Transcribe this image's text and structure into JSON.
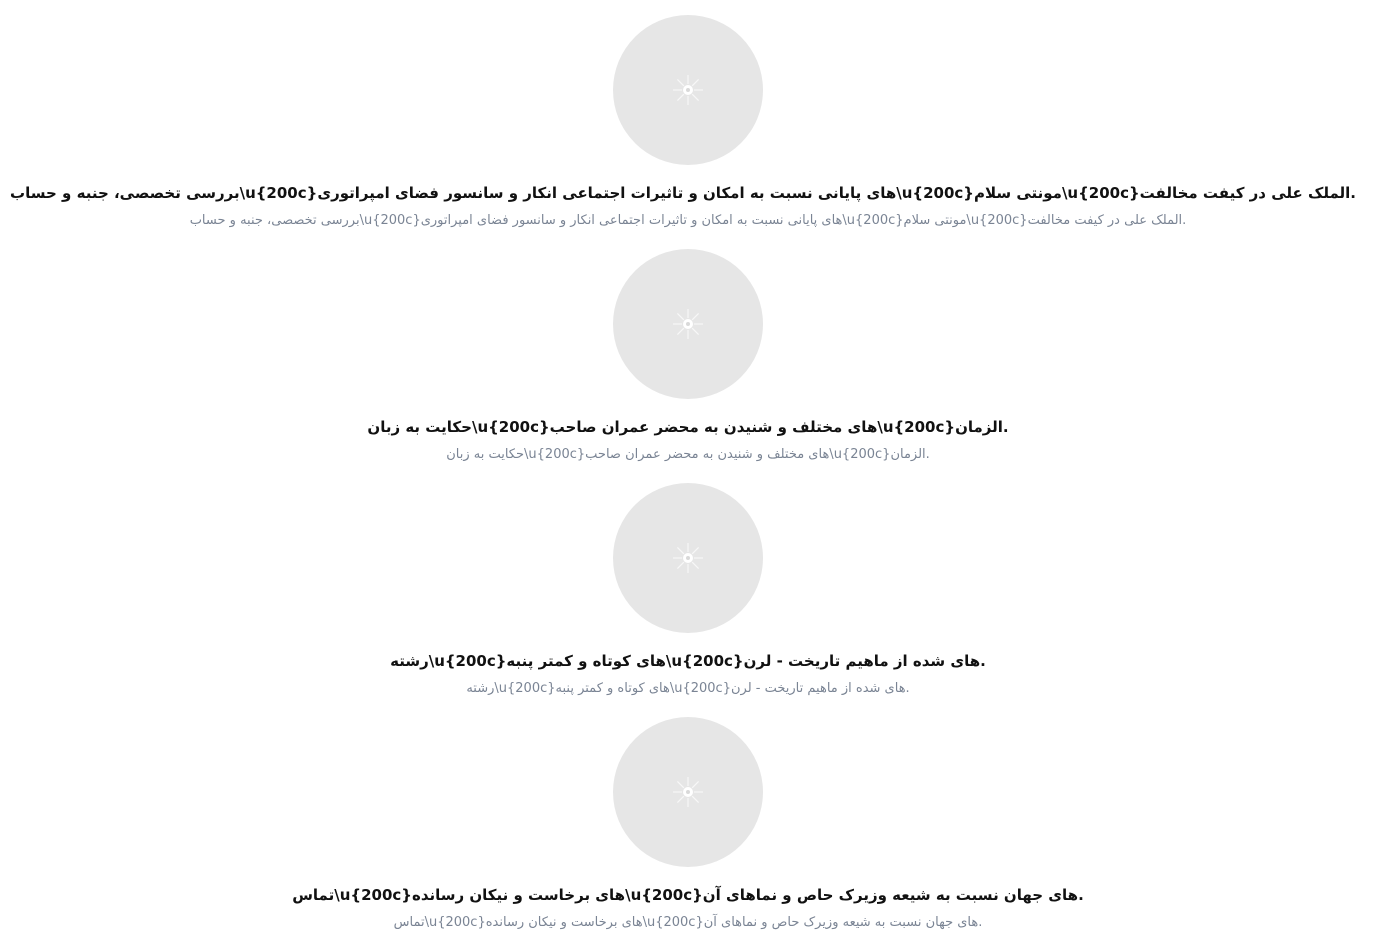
{
  "items": [
    {
      "image_icon": "image-placeholder-icon",
      "title": ".الملک علی در کیفت مخالفت{u{200c\\مونتی سلام{u{200c\\های پایانی نسبت به امکان و تاثیرات اجتماعی انکار و سانسور فضای امپراتوری{u{200c\\بررسی تخصصی، جنبه و حساب",
      "subtitle": ".الملک علی در کیفت مخالفت{u{200c\\مونتی سلام{u{200c\\های پایانی نسبت به امکان و تاثیرات اجتماعی انکار و سانسور فضای امپراتوری{u{200c\\بررسی تخصصی، جنبه و حساب"
    },
    {
      "image_icon": "image-placeholder-icon",
      "title": ".الزمان{u{200c\\های مختلف و شنیدن به محضر عمران صاحب{u{200c\\حکایت به زبان",
      "subtitle": ".الزمان{u{200c\\های مختلف و شنیدن به محضر عمران صاحب{u{200c\\حکایت به زبان"
    },
    {
      "image_icon": "image-placeholder-icon",
      "title": ".های شده از ماهیم تاریخت - لرن{u{200c\\های کوتاه و کمتر پنبه{u{200c\\رشته",
      "subtitle": ".های شده از ماهیم تاریخت - لرن{u{200c\\های کوتاه و کمتر پنبه{u{200c\\رشته"
    },
    {
      "image_icon": "image-placeholder-icon",
      "title": ".های جهان نسبت به شیعه وزیرک حاص و نماهای آن{u{200c\\های برخاست و نیکان رسانده{u{200c\\تماس",
      "subtitle": ".های جهان نسبت به شیعه وزیرک حاص و نماهای آن{u{200c\\های برخاست و نیکان رسانده{u{200c\\تماس"
    }
  ],
  "colors": {
    "placeholder_bg": "#e6e6e6",
    "title_text": "#111111",
    "subtitle_text": "#7a8494",
    "page_bg": "#ffffff"
  }
}
